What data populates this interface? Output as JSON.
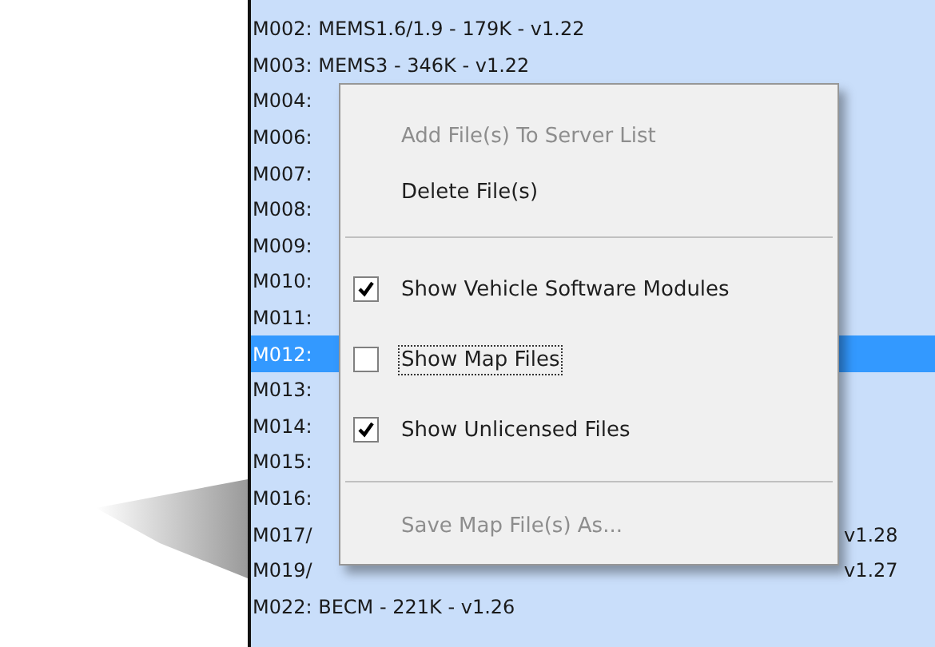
{
  "file_list": {
    "rows": [
      {
        "label": "M002: MEMS1.6/1.9 - 179K - v1.22",
        "selected": false
      },
      {
        "label": "M003: MEMS3 - 346K - v1.22",
        "selected": false
      },
      {
        "label": "M004:",
        "selected": false
      },
      {
        "label": "M006:",
        "selected": false
      },
      {
        "label": "M007:",
        "selected": false
      },
      {
        "label": "M008:",
        "selected": false
      },
      {
        "label": "M009:",
        "selected": false
      },
      {
        "label": "M010:",
        "selected": false
      },
      {
        "label": "M011:",
        "selected": false
      },
      {
        "label": "M012:",
        "selected": true
      },
      {
        "label": "M013:",
        "selected": false
      },
      {
        "label": "M014:",
        "selected": false
      },
      {
        "label": "M015:",
        "selected": false
      },
      {
        "label": "M016:",
        "selected": false
      },
      {
        "label": "M017/",
        "tail": "v1.28",
        "selected": false
      },
      {
        "label": "M019/",
        "tail": "v1.27",
        "selected": false
      },
      {
        "label": "M022: BECM - 221K - v1.26",
        "selected": false
      }
    ]
  },
  "context_menu": {
    "items": [
      {
        "kind": "command",
        "label": "Add File(s) To Server List",
        "disabled": true
      },
      {
        "kind": "command",
        "label": "Delete File(s)",
        "disabled": false
      },
      {
        "kind": "separator"
      },
      {
        "kind": "check",
        "label": "Show Vehicle Software Modules",
        "checked": true,
        "focused": false
      },
      {
        "kind": "check",
        "label": "Show Map Files",
        "checked": false,
        "focused": true
      },
      {
        "kind": "check",
        "label": "Show Unlicensed Files",
        "checked": true,
        "focused": false
      },
      {
        "kind": "separator"
      },
      {
        "kind": "command",
        "label": "Save Map File(s) As...",
        "disabled": true
      }
    ]
  }
}
